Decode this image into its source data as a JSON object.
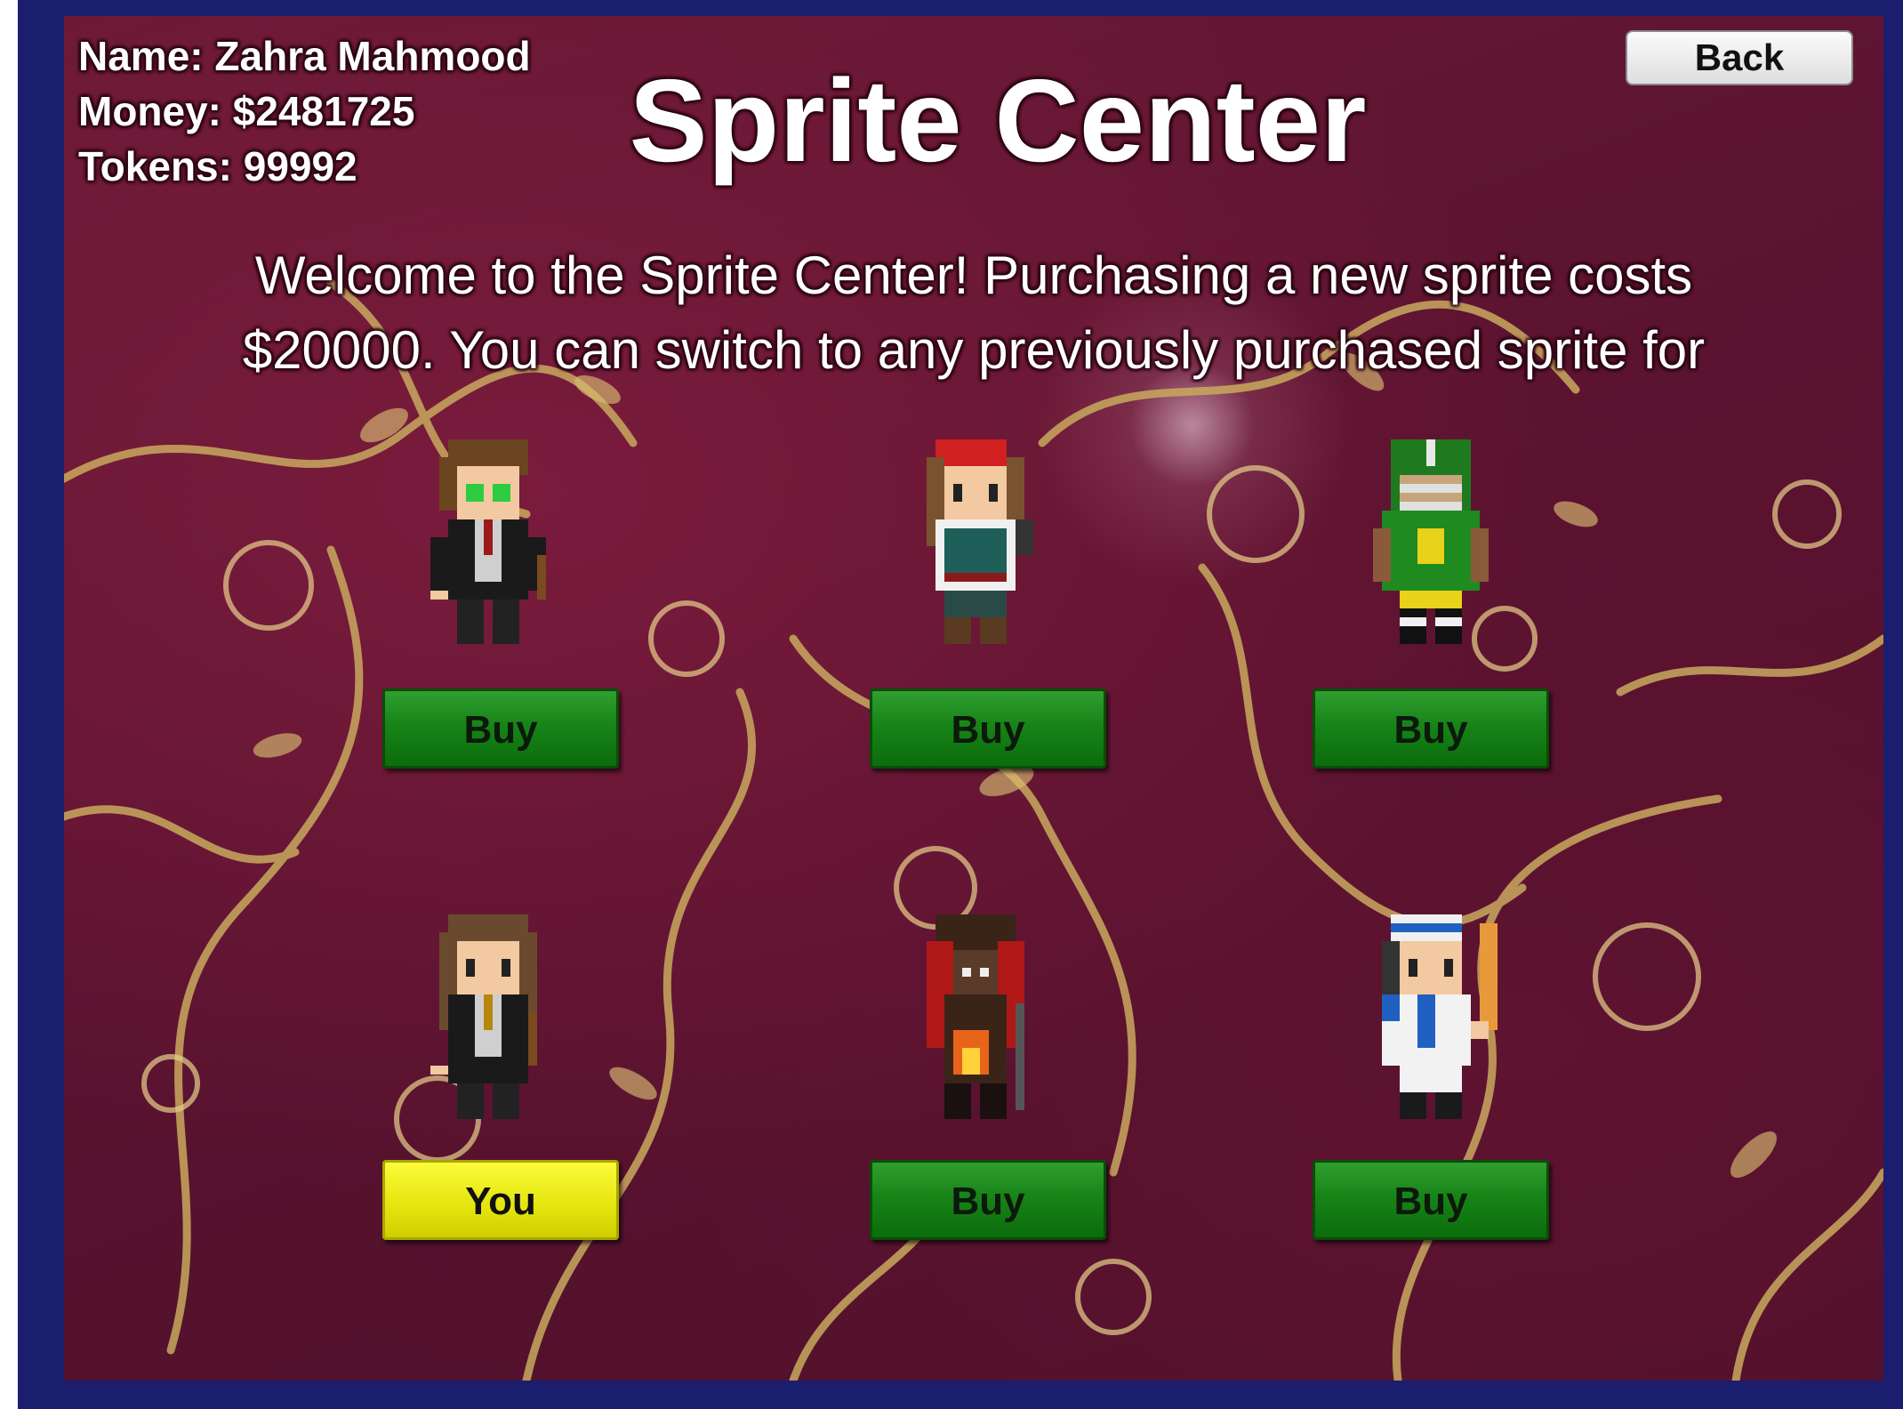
{
  "player": {
    "name_line": "Name: Zahra Mahmood",
    "money_line": "Money: $2481725",
    "tokens_line": "Tokens: 99992"
  },
  "title": "Sprite Center",
  "welcome_lines": [
    "Welcome to the Sprite Center!  Purchasing a new sprite costs",
    "$20000. You can switch to any previously purchased sprite for"
  ],
  "back_label": "Back",
  "sprites": [
    {
      "character": "wizard-boy",
      "label": "Buy"
    },
    {
      "character": "pirate-girl",
      "label": "Buy"
    },
    {
      "character": "football-player",
      "label": "Buy"
    },
    {
      "character": "wizard-girl",
      "label": "You"
    },
    {
      "character": "fire-mage",
      "label": "Buy"
    },
    {
      "character": "baseball-player",
      "label": "Buy"
    }
  ],
  "colors": {
    "frame": "#1b1d6e",
    "background": "#5a1330",
    "buy_button": "#188418",
    "selected_button": "#e4e40e"
  }
}
